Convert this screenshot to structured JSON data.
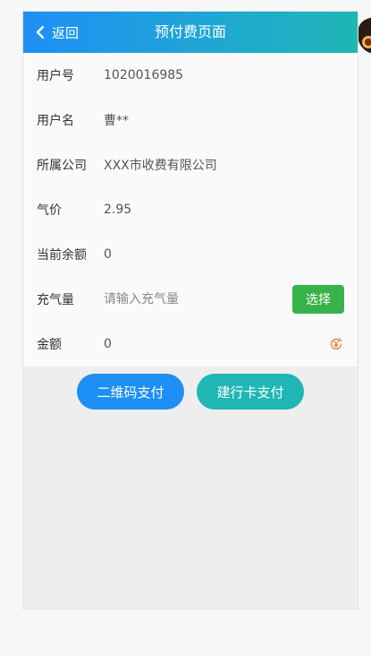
{
  "header": {
    "back_label": "返回",
    "title": "预付费页面"
  },
  "form": {
    "rows": [
      {
        "label": "用户号",
        "value": "1020016985"
      },
      {
        "label": "用户名",
        "value": "曹**"
      },
      {
        "label": "所属公司",
        "value": "XXX市收费有限公司"
      },
      {
        "label": "气价",
        "value": "2.95"
      },
      {
        "label": "当前余额",
        "value": "0"
      }
    ],
    "gas_amount": {
      "label": "充气量",
      "placeholder": "请输入充气量",
      "value": "",
      "select_label": "选择"
    },
    "amount": {
      "label": "金额",
      "value": "0",
      "icon": "yuan-refresh-icon"
    }
  },
  "actions": {
    "qr_pay_label": "二维码支付",
    "ccb_pay_label": "建行卡支付"
  },
  "colors": {
    "header_start": "#1e8ff6",
    "header_end": "#1fb6b4",
    "select_button": "#38b24a",
    "qr_button": "#1e8ff6",
    "ccb_button": "#1fb6b4",
    "amount_icon": "#e8833a"
  }
}
